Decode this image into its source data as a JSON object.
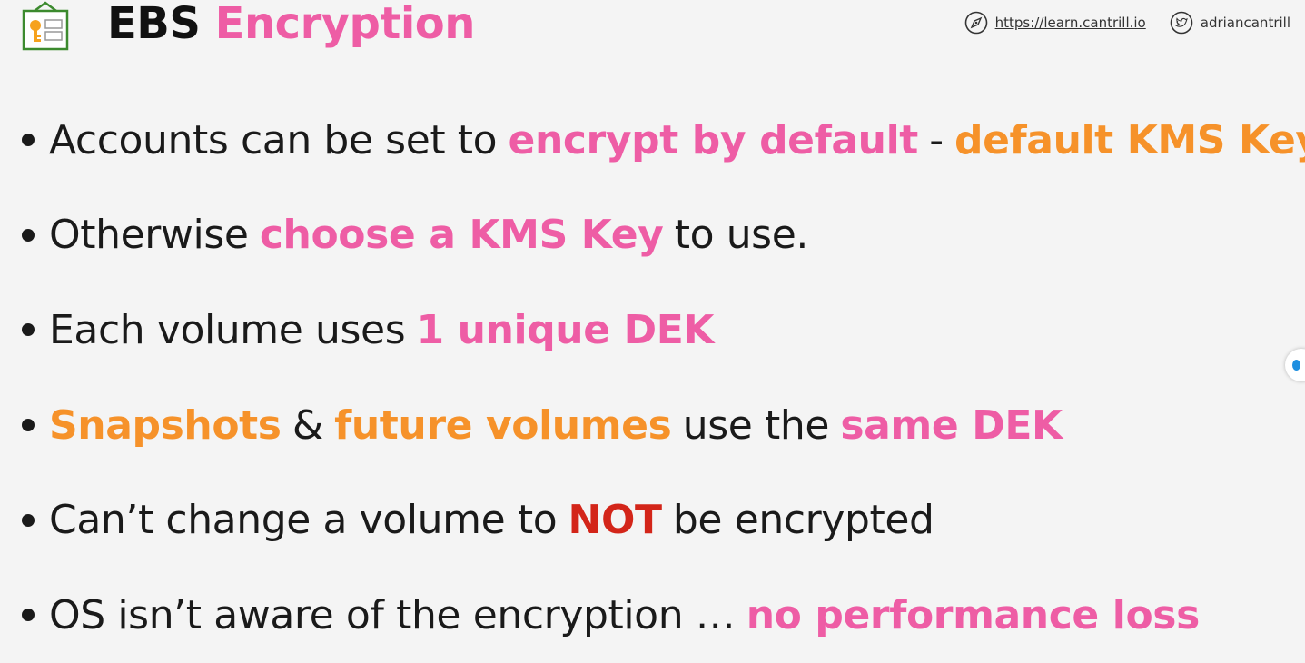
{
  "header": {
    "title_part1": "EBS",
    "title_part2": "Encryption",
    "website": "https://learn.cantrill.io",
    "twitter": "adriancantrill",
    "icons": {
      "logo": "kms-key-icon",
      "website": "compass-icon",
      "twitter": "twitter-bird-icon"
    }
  },
  "colors": {
    "pink": "#ee5da5",
    "orange": "#f6922a",
    "red": "#d32519",
    "text": "#1a1a1a"
  },
  "bullets": [
    [
      {
        "text": "Accounts can be set to",
        "style": "plain"
      },
      {
        "text": "encrypt by default",
        "style": "pink"
      },
      {
        "text": "-",
        "style": "plain"
      },
      {
        "text": "default KMS Key",
        "style": "orange"
      }
    ],
    [
      {
        "text": "Otherwise",
        "style": "plain"
      },
      {
        "text": "choose a KMS Key",
        "style": "pink"
      },
      {
        "text": "to use.",
        "style": "plain"
      }
    ],
    [
      {
        "text": "Each volume uses",
        "style": "plain"
      },
      {
        "text": "1 unique DEK",
        "style": "pink"
      }
    ],
    [
      {
        "text": "Snapshots",
        "style": "orange"
      },
      {
        "text": "&",
        "style": "plain"
      },
      {
        "text": "future volumes",
        "style": "orange"
      },
      {
        "text": "use the",
        "style": "plain"
      },
      {
        "text": "same DEK",
        "style": "pink"
      }
    ],
    [
      {
        "text": "Can’t change a volume to",
        "style": "plain"
      },
      {
        "text": "NOT",
        "style": "red"
      },
      {
        "text": "be encrypted",
        "style": "plain"
      }
    ],
    [
      {
        "text": "OS isn’t aware of the encryption …",
        "style": "plain"
      },
      {
        "text": "no performance loss",
        "style": "pink"
      }
    ]
  ]
}
